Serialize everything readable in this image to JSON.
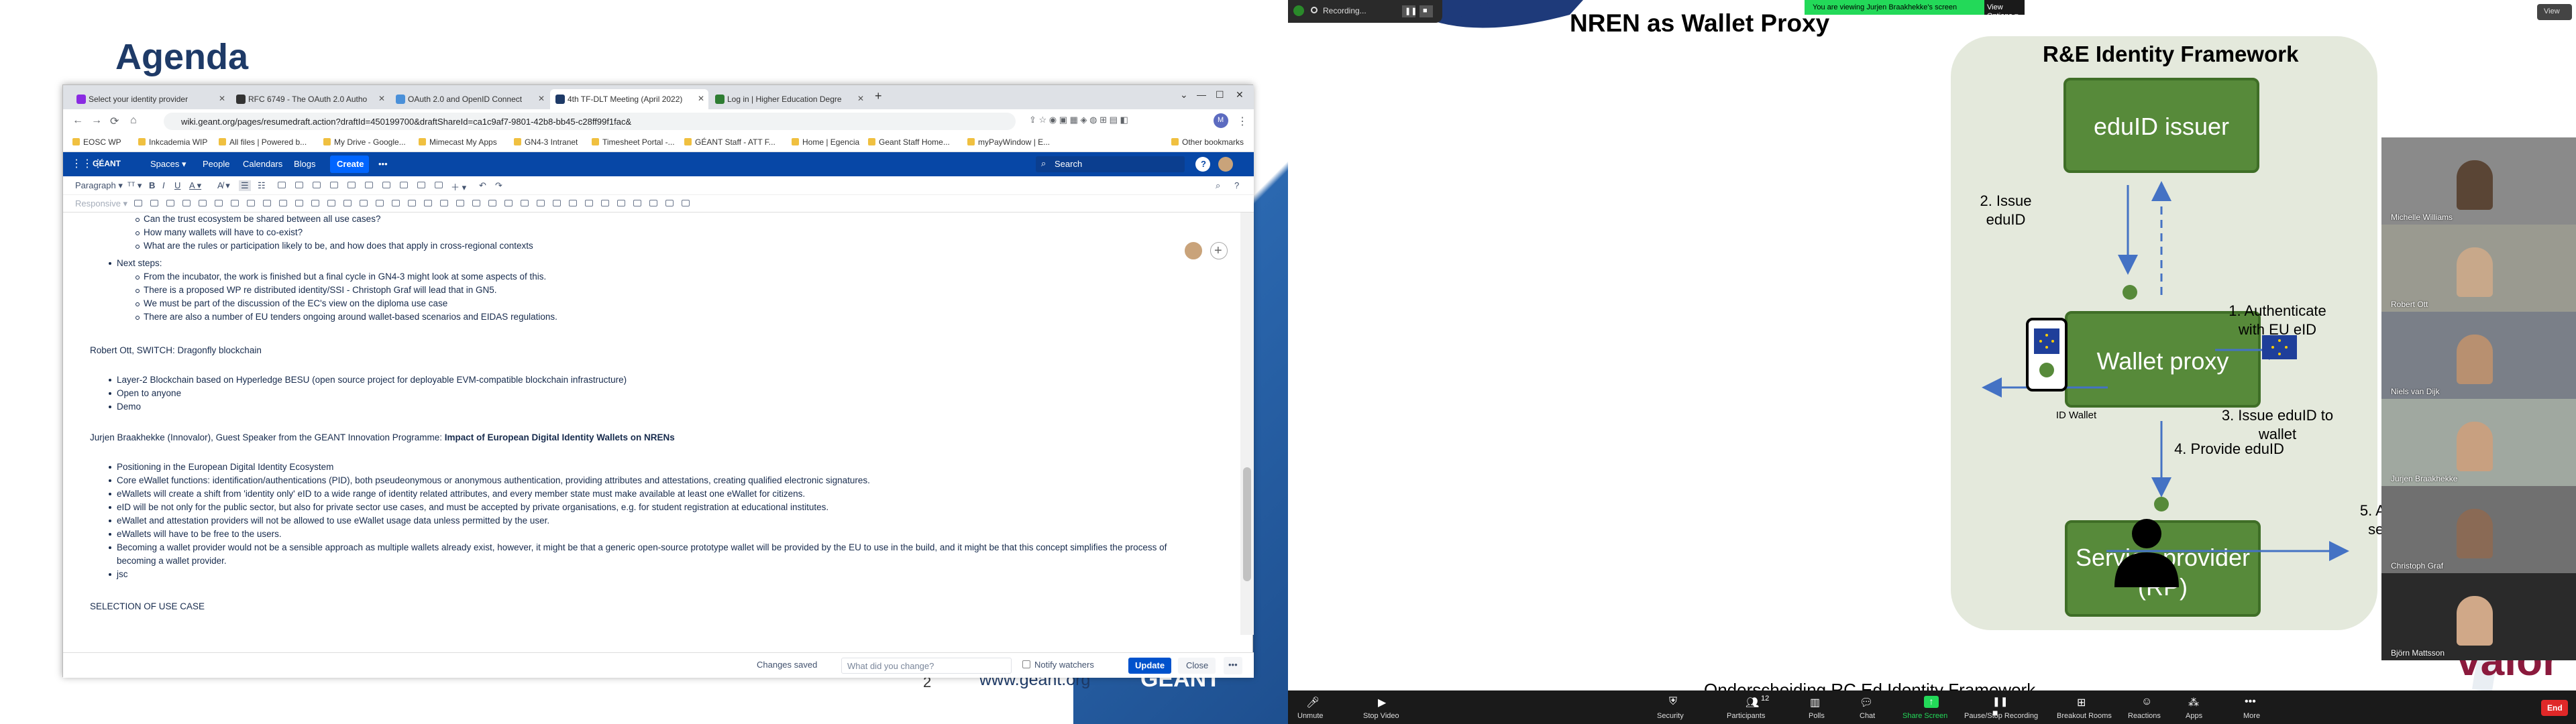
{
  "left_slide": {
    "title": "Agenda",
    "page_number": "2",
    "url": "www.geant.org",
    "brand": "GÉANT"
  },
  "browser": {
    "tabs": [
      {
        "label": "Select your identity provider",
        "color": "#8a2be2"
      },
      {
        "label": "RFC 6749 - The OAuth 2.0 Autho",
        "color": "#333333"
      },
      {
        "label": "OAuth 2.0 and OpenID Connect",
        "color": "#4a90d9"
      },
      {
        "label": "4th TF-DLT Meeting (April 2022)",
        "color": "#1e3a67"
      },
      {
        "label": "Log in | Higher Education Degre",
        "color": "#2e7d32"
      }
    ],
    "url": "wiki.geant.org/pages/resumedraft.action?draftId=450199700&draftShareId=ca1c9af7-9801-42b8-bb45-c28ff99f1fac&",
    "bookmarks": [
      "EOSC WP",
      "Inkcademia WIP",
      "All files | Powered b...",
      "My Drive - Google...",
      "Mimecast My Apps",
      "GN4-3 Intranet",
      "Timesheet Portal -...",
      "GÉANT Staff - ATT F...",
      "Home | Egencia",
      "Geant Staff Home...",
      "myPayWindow | E...",
      "Other bookmarks"
    ]
  },
  "confluence": {
    "logo": "GÉANT",
    "nav": [
      "Spaces",
      "People",
      "Calendars",
      "Blogs"
    ],
    "create": "Create",
    "more": "•••",
    "search_placeholder": "Search",
    "paragraph_select": "Paragraph",
    "responsive_select": "Responsive"
  },
  "document": {
    "lines": [
      {
        "lvl": 2,
        "text": "Can the trust ecosystem be shared between all use cases?"
      },
      {
        "lvl": 2,
        "text": "How many wallets will have to co-exist?"
      },
      {
        "lvl": 2,
        "text": "What are the rules or participation likely to be, and how does that apply in cross-regional contexts"
      },
      {
        "lvl": 1,
        "text": "Next steps:"
      },
      {
        "lvl": 2,
        "text": "From the incubator, the work is finished but a final cycle in GN4-3 might look at some aspects of this."
      },
      {
        "lvl": 2,
        "text": "There is a proposed WP re distributed identity/SSI - Christoph Graf will lead that in GN5."
      },
      {
        "lvl": 2,
        "text": "We must be part of the discussion of the EC's view on the diploma use case"
      },
      {
        "lvl": 2,
        "text": "There are also a number of EU tenders ongoing around wallet-based scenarios and EIDAS regulations."
      },
      {
        "lvl": 0,
        "text": ""
      },
      {
        "lvl": 0,
        "text": "Robert Ott, SWITCH: Dragonfly blockchain"
      },
      {
        "lvl": 0,
        "text": ""
      },
      {
        "lvl": 1,
        "text": "Layer-2 Blockchain based on Hyperledge BESU (open source project for deployable EVM-compatible blockchain infrastructure)"
      },
      {
        "lvl": 1,
        "text": "Open to anyone"
      },
      {
        "lvl": 1,
        "text": "Demo"
      },
      {
        "lvl": 0,
        "text": ""
      },
      {
        "lvl": 0,
        "text": "Jurjen Braakhekke (Innovalor), Guest Speaker from the GEANT Innovation Programme: ",
        "bold": "Impact of European Digital Identity Wallets on NRENs"
      },
      {
        "lvl": 0,
        "text": ""
      },
      {
        "lvl": 1,
        "text": "Positioning in the European Digital Identity Ecosystem"
      },
      {
        "lvl": 1,
        "text": "Core eWallet functions: identification/authentications (PID), both pseudeonymous or anonymous authentication, providing attributes and attestations, creating qualified electronic signatures."
      },
      {
        "lvl": 1,
        "text": "eWallets will create a shift from 'identity only' eID to a wide range of identity related attributes, and every member state must make available at least one eWallet for citizens."
      },
      {
        "lvl": 1,
        "text": "eID will be not only for the public sector, but also for private sector use cases, and must be accepted by private organisations, e.g. for student registration at educational institutes."
      },
      {
        "lvl": 1,
        "text": "eWallet and attestation providers will not be allowed to use eWallet usage data unless permitted by the user."
      },
      {
        "lvl": 1,
        "text": "eWallets will have to be free to the users."
      },
      {
        "lvl": 1,
        "text": "Becoming a wallet provider would not be a sensible approach as multiple wallets already exist, however, it might be that a generic open-source prototype wallet will be provided by the EU to use in the build, and it might be that this concept simplifies the process of"
      },
      {
        "lvl": 3,
        "text": "becoming a wallet provider."
      },
      {
        "lvl": 1,
        "text": "jsc"
      },
      {
        "lvl": 0,
        "text": ""
      },
      {
        "lvl": 0,
        "text": "SELECTION OF USE CASE"
      }
    ],
    "footer": {
      "saved": "Changes saved",
      "change_placeholder": "What did you change?",
      "notify": "Notify watchers",
      "update": "Update",
      "close": "Close"
    }
  },
  "shared_slide": {
    "title": "NREN as Wallet Proxy",
    "framework_title": "R&E Identity Framework",
    "boxes": {
      "eduid_issuer": "eduID issuer",
      "wallet_proxy": "Wallet proxy",
      "service_provider": "Service provider (RP)"
    },
    "labels": {
      "issue_eduid": "2. Issue eduID",
      "authenticate": "1. Authenticate with EU eID",
      "issue_to_wallet": "3. Issue eduID to wallet",
      "provide_eduid": "4. Provide eduID",
      "access": "5. Access service",
      "id_wallet": "ID Wallet"
    },
    "cut_caption": "Onderscheiding RC Ed Identity Framework",
    "brand_fragment": "valor"
  },
  "zoom": {
    "recording": "Recording...",
    "viewing": "You are viewing Jurjen Braakhekke's screen",
    "view_options": "View Options",
    "view_label": "View",
    "participants": [
      {
        "name": "Michelle Williams",
        "bg": "#8a8a8a"
      },
      {
        "name": "Robert Ott",
        "bg": "#9a9a90"
      },
      {
        "name": "Niels van Dijk",
        "bg": "#7a7f88"
      },
      {
        "name": "Jurjen Braakhekke",
        "bg": "#a0a8a0"
      },
      {
        "name": "Christoph Graf",
        "bg": "#707070"
      },
      {
        "name": "Björn Mattsson",
        "bg": "#2a2a2a"
      }
    ],
    "bar": [
      "Unmute",
      "Stop Video",
      "Security",
      "Participants",
      "Polls",
      "Chat",
      "Share Screen",
      "Pause/Stop Recording",
      "Breakout Rooms",
      "Reactions",
      "Apps",
      "More"
    ],
    "participant_count": "12",
    "end": "End"
  }
}
